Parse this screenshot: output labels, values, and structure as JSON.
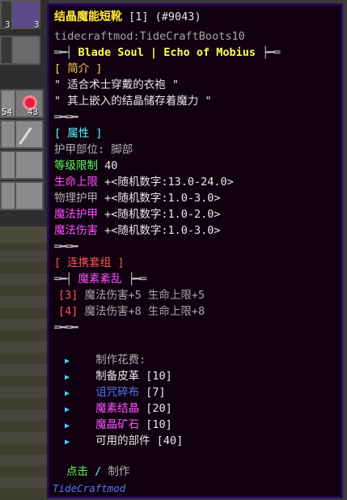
{
  "background": {
    "slot_counts": [
      "3",
      "4",
      "54",
      "43"
    ]
  },
  "tooltip": {
    "title": "结晶魔能短靴",
    "count": "[1]",
    "id": "(#9043)",
    "registry": "tidecraftmod:TideCraftBoots10",
    "lore_left_sep": "═━┤",
    "lore_title": "Blade Soul | Echo of Mobius",
    "lore_right_sep": "┝━═",
    "intro_header": "[ 简介 ]",
    "intro_lines": [
      "\" 适合术士穿戴的衣袍 \"",
      "\" 其上嵌入的结晶储存着魔力 \""
    ],
    "divider": "═━═━",
    "attr_header": "[ 属性 ]",
    "slot_label": "护甲部位: 脚部",
    "level_label": "等级限制",
    "level_value": "40",
    "stats": [
      {
        "label": "生命上限",
        "value": "+<随机数字:13.0-24.0>",
        "color": "#ff55ff"
      },
      {
        "label": "物理护甲",
        "value": "+<随机数字:1.0-3.0>",
        "color": "#b0b0b0"
      },
      {
        "label": "魔法护甲",
        "value": "+<随机数字:1.0-2.0>",
        "color": "#ff55ff"
      },
      {
        "label": "魔法伤害",
        "value": "+<随机数字:1.0-3.0>",
        "color": "#ff55ff"
      }
    ],
    "set_header": "[ 连携套组 ]",
    "set_name_left": "═━┤",
    "set_name": "魔素紊乱",
    "set_name_right": "┝━═",
    "set_bonuses": [
      {
        "count": "[3]",
        "text": "魔法伤害+5 生命上限+5"
      },
      {
        "count": "[4]",
        "text": "魔法伤害+8 生命上限+8"
      }
    ],
    "craft_bullet": "▶",
    "craft_title": "制作花费:",
    "craft_items": [
      {
        "name": "制备皮革",
        "qty": "[10]",
        "color": "#e8e8e8"
      },
      {
        "name": "诅咒碎布",
        "qty": "[7]",
        "color": "#5577ff"
      },
      {
        "name": "魔素结晶",
        "qty": "[20]",
        "color": "#ff55ff"
      },
      {
        "name": "魔晶矿石",
        "qty": "[10]",
        "color": "#ff55ff"
      },
      {
        "name": "可用的部件",
        "qty": "[40]",
        "color": "#e8e8e8"
      }
    ],
    "click_label": "点击",
    "click_sep": "/",
    "click_action": "制作",
    "mod_name": "TideCraftmod"
  }
}
